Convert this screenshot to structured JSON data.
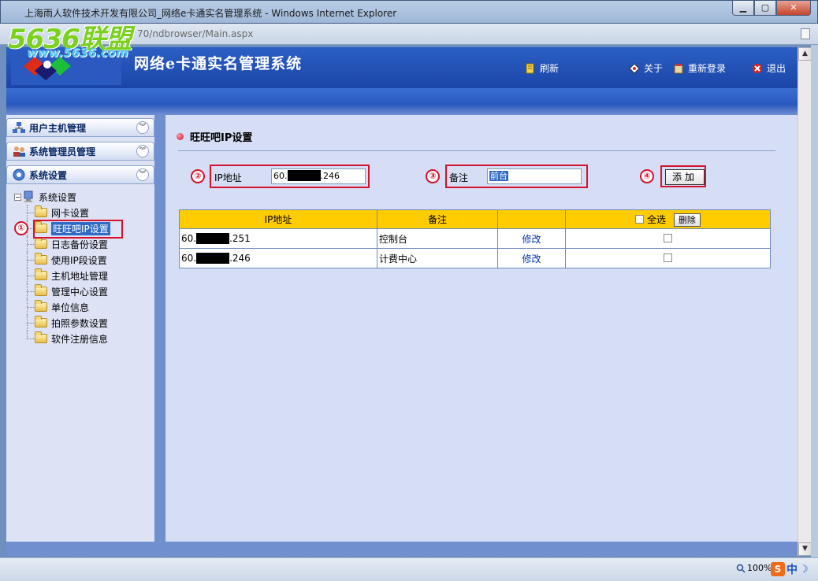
{
  "window": {
    "title": "上海雨人软件技术开发有限公司_网络e卡通实名管理系统 - Windows Internet Explorer",
    "address_partial": "70/ndbrowser/Main.aspx",
    "min_symbol": "▁",
    "max_symbol": "▢",
    "close_symbol": "✕"
  },
  "watermark": {
    "brand": "5636联盟",
    "url": "www.5636.com"
  },
  "header": {
    "app_title": "网络e卡通实名管理系统",
    "refresh": "刷新",
    "about": "关于",
    "relogin": "重新登录",
    "logout": "退出"
  },
  "sidebar": {
    "sections": [
      {
        "label": "用户主机管理",
        "toggle": "︾"
      },
      {
        "label": "系统管理员管理",
        "toggle": "︾"
      },
      {
        "label": "系统设置",
        "toggle": "︾"
      }
    ],
    "tree_root": "系统设置",
    "tree_items": [
      "网卡设置",
      "旺旺吧IP设置",
      "日志备份设置",
      "使用IP段设置",
      "主机地址管理",
      "管理中心设置",
      "单位信息",
      "拍照参数设置",
      "软件注册信息"
    ],
    "selected_index": 1
  },
  "annotations": [
    "①",
    "②",
    "③",
    "④"
  ],
  "main": {
    "section_title": "旺旺吧IP设置",
    "ip_label": "IP地址",
    "ip_prefix": "60.",
    "ip_suffix": ".246",
    "note_label": "备注",
    "note_value": "前台",
    "add_button": "添加",
    "table": {
      "headers": [
        "IP地址",
        "备注",
        "",
        "全选"
      ],
      "delete_button": "删除",
      "rows": [
        {
          "ip_prefix": "60.",
          "ip_suffix": ".251",
          "note": "控制台",
          "action": "修改"
        },
        {
          "ip_prefix": "60.",
          "ip_suffix": ".246",
          "note": "计费中心",
          "action": "修改"
        }
      ]
    }
  },
  "statusbar": {
    "zoom": "100%",
    "ime_logo": "S",
    "ime_lang": "中",
    "ime_moon": "☽"
  },
  "scrollbar": {
    "up": "▲",
    "down": "▼"
  }
}
